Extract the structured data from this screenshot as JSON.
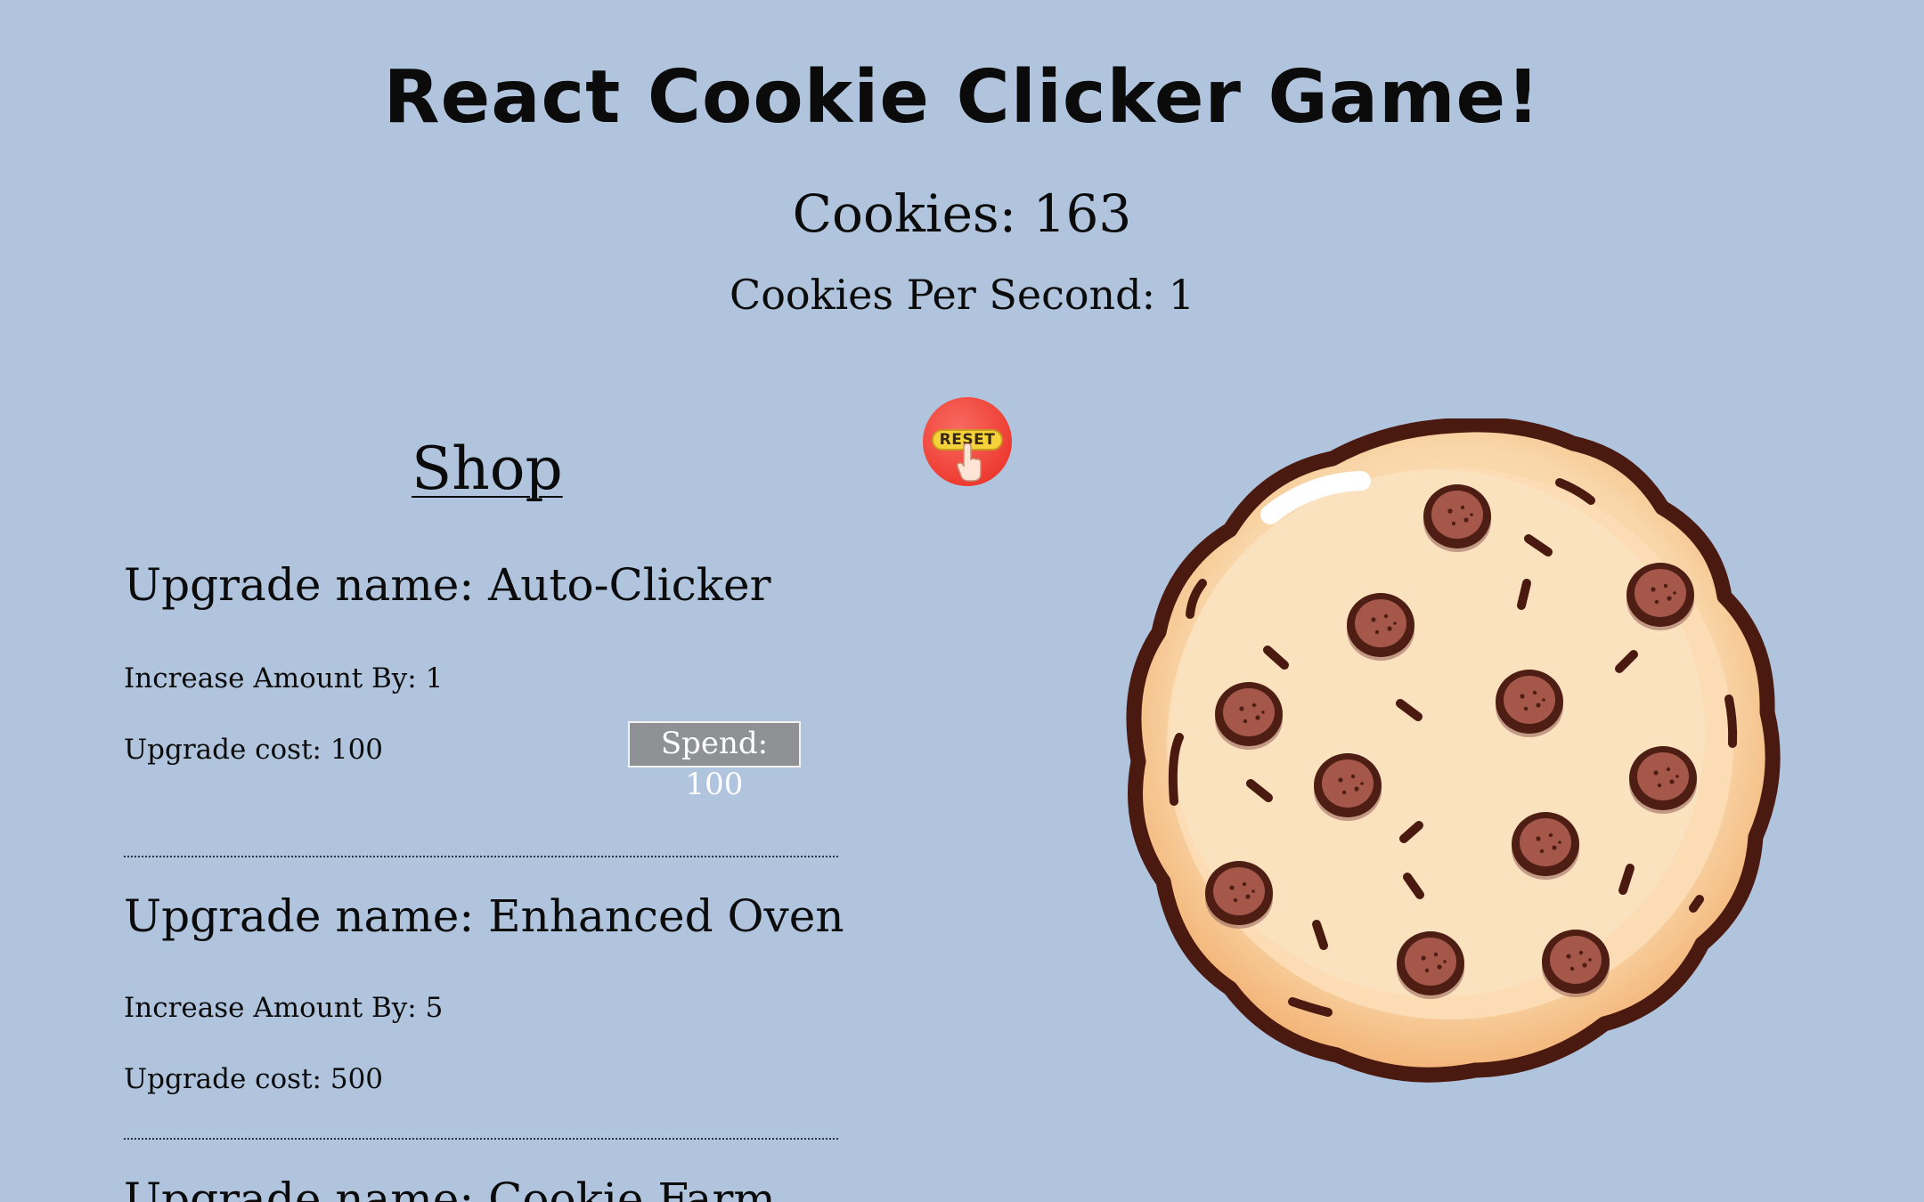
{
  "header": {
    "title": "React Cookie Clicker Game!",
    "cookies_label": "Cookies: 163",
    "cps_label": "Cookies Per Second: 1"
  },
  "reset": {
    "label": "RESET",
    "icon": "reset-hand-icon",
    "color": "#ee3d33"
  },
  "shop": {
    "title": "Shop",
    "upgrades": [
      {
        "name": "Upgrade name: Auto-Clicker",
        "increase": "Increase Amount By: 1",
        "cost": "Upgrade cost: 100",
        "spend": "Spend: 100"
      },
      {
        "name": "Upgrade name: Enhanced Oven",
        "increase": "Increase Amount By: 5",
        "cost": "Upgrade cost: 500"
      },
      {
        "name": "Upgrade name: Cookie Farm"
      }
    ]
  },
  "cookie": {
    "icon": "cookie-icon"
  },
  "colors": {
    "background": "#b0c4de",
    "spend_button": "#8f9195"
  }
}
